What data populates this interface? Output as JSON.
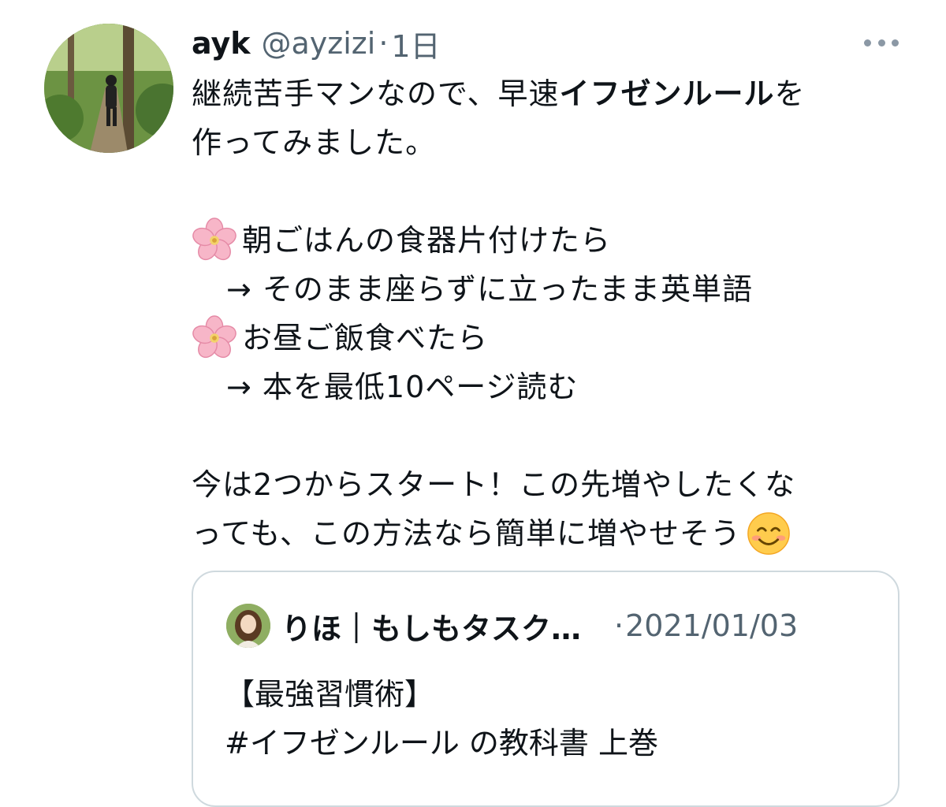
{
  "tweet": {
    "author_name": "ayk",
    "author_handle": "@ayzizi",
    "separator": "·",
    "time": "1日",
    "avatar_icon": "profile-photo-forest-path",
    "more_icon": "more-horizontal-icon",
    "text": {
      "line1_a": "継続苦手マンなので、早速",
      "line1_b": "イフゼンルール",
      "line1_c": "を",
      "line2": "作ってみました。",
      "item1": "朝ごはんの食器片付けたら",
      "item1_action": "→ そのまま座らずに立ったまま英単語",
      "item2": "お昼ご飯食べたら",
      "item2_action": "→ 本を最低10ページ読む",
      "line7": "今は2つからスタート！この先増やしたくな",
      "line8": "っても、この方法なら簡単に増やせそう"
    },
    "bullet_icon": "cherry-blossom-emoji",
    "end_emoji": "smiling-face-emoji"
  },
  "quote": {
    "author_name": "りほ｜もしもタスク…",
    "separator": "·",
    "date": "2021/01/03",
    "avatar_icon": "profile-photo-woman",
    "line1": "【最強習慣術】",
    "line2": "#イフゼンルール の教科書 上巻"
  },
  "colors": {
    "text": "#0f1419",
    "secondary": "#536471",
    "border": "#cfd9de",
    "background": "#ffffff"
  }
}
